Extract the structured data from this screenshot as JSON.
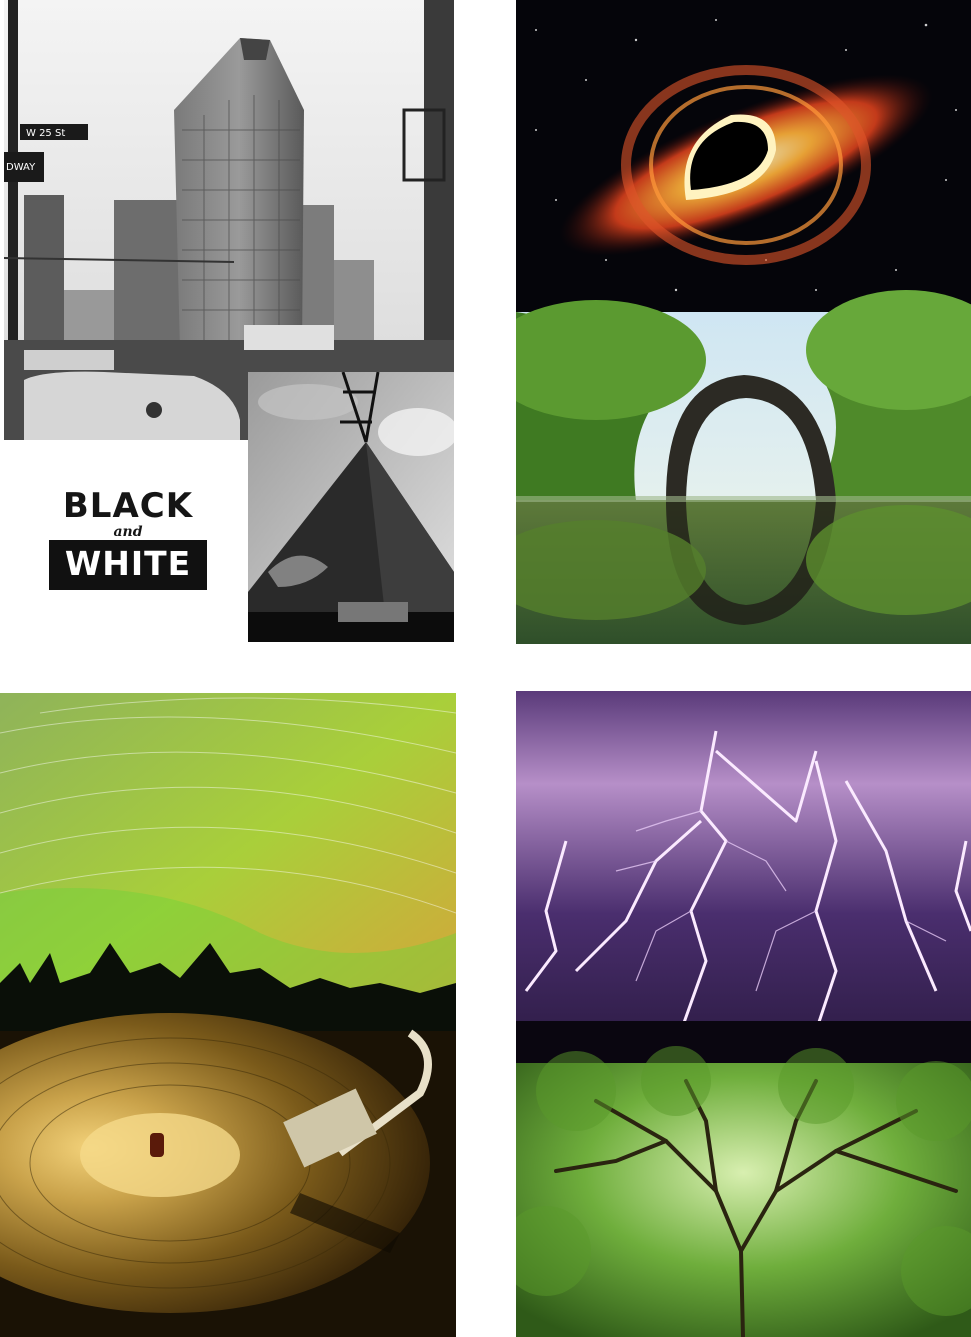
{
  "collage": {
    "bw_logo": {
      "line1": "BLACK",
      "line2": "and",
      "line3": "WHITE"
    },
    "street_signs": {
      "w25": "W 25 St",
      "broadway": "DWAY"
    },
    "tiles": [
      {
        "name": "black-and-white-city",
        "icon": "building-photo"
      },
      {
        "name": "black-hole",
        "icon": "space-photo"
      },
      {
        "name": "arch-bridge",
        "icon": "bridge-photo"
      },
      {
        "name": "aurora-star-trails",
        "icon": "aurora-photo"
      },
      {
        "name": "record-turntable",
        "icon": "vinyl-photo"
      },
      {
        "name": "lightning-storm",
        "icon": "lightning-photo"
      },
      {
        "name": "tree-canopy",
        "icon": "tree-photo"
      }
    ],
    "colors": {
      "background": "#ffffff",
      "space": "#05050a",
      "accretion_orange": "#ff8a1e",
      "forest_green": "#4f8a2a",
      "aurora_green": "#8fd63a",
      "vinyl_gold": "#c9a24a",
      "storm_purple": "#4a2e6e",
      "canopy_green": "#6fae3c"
    }
  }
}
